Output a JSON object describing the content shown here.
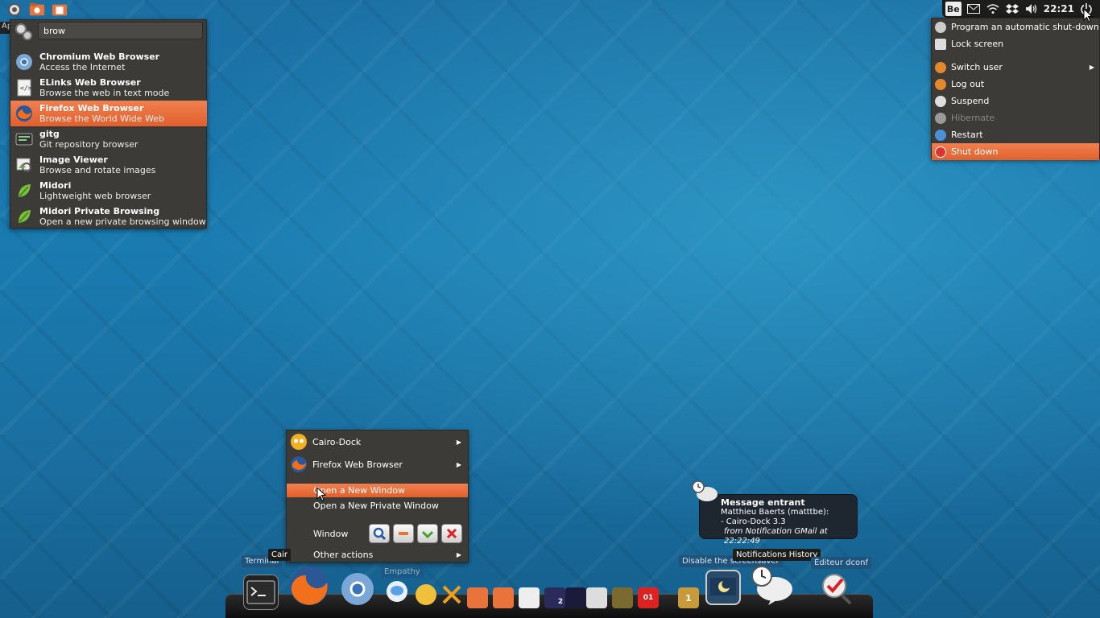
{
  "top_left": {
    "apps_label": "Ap"
  },
  "search": {
    "query": "brow",
    "results": [
      {
        "name": "Chromium Web Browser",
        "desc": "Access the Internet",
        "selected": false
      },
      {
        "name": "ELinks Web Browser",
        "desc": "Browse the web in text mode",
        "selected": false
      },
      {
        "name": "Firefox Web Browser",
        "desc": "Browse the World Wide Web",
        "selected": true
      },
      {
        "name": "gitg",
        "desc": "Git repository browser",
        "selected": false
      },
      {
        "name": "Image Viewer",
        "desc": "Browse and rotate images",
        "selected": false
      },
      {
        "name": "Midori",
        "desc": "Lightweight web browser",
        "selected": false
      },
      {
        "name": "Midori Private Browsing",
        "desc": "Open a new private browsing window",
        "selected": false
      }
    ]
  },
  "top_panel": {
    "keyboard_layout": "Be",
    "clock": "22:21"
  },
  "session_menu": {
    "items": [
      {
        "label": "Program an automatic shut-down",
        "state": "normal"
      },
      {
        "label": "Lock screen",
        "state": "normal"
      },
      {
        "label": "Switch user",
        "state": "normal",
        "submenu": true
      },
      {
        "label": "Log out",
        "state": "normal"
      },
      {
        "label": "Suspend",
        "state": "normal"
      },
      {
        "label": "Hibernate",
        "state": "disabled"
      },
      {
        "label": "Restart",
        "state": "normal"
      },
      {
        "label": "Shut down",
        "state": "selected"
      }
    ]
  },
  "context_menu": {
    "cairo_dock": "Cairo-Dock",
    "firefox": "Firefox Web Browser",
    "open_new_window": "Open a New Window",
    "open_private_window": "Open a New Private Window",
    "window_label": "Window",
    "other_actions": "Other actions"
  },
  "tooltips": {
    "terminal": "Terminal",
    "cairo": "Cair",
    "empathy": "Empathy",
    "disable_screensaver": "Disable the screensaver",
    "notifications_history": "Notifications History",
    "editeur_dconf": "Éditeur dconf"
  },
  "notification": {
    "title": "Message entrant",
    "line1": "Matthieu Baerts (matttbe):",
    "line2": "- Cairo-Dock 3.3",
    "from": "from Notification GMail at 22:22:49"
  },
  "dock": {
    "workspace_badge": "2",
    "calendar_badge": "01",
    "trash_badge": "1"
  },
  "colors": {
    "menu_bg": "#3c3b37",
    "accent": "#e86b38",
    "desktop": "#1a7bb0"
  }
}
